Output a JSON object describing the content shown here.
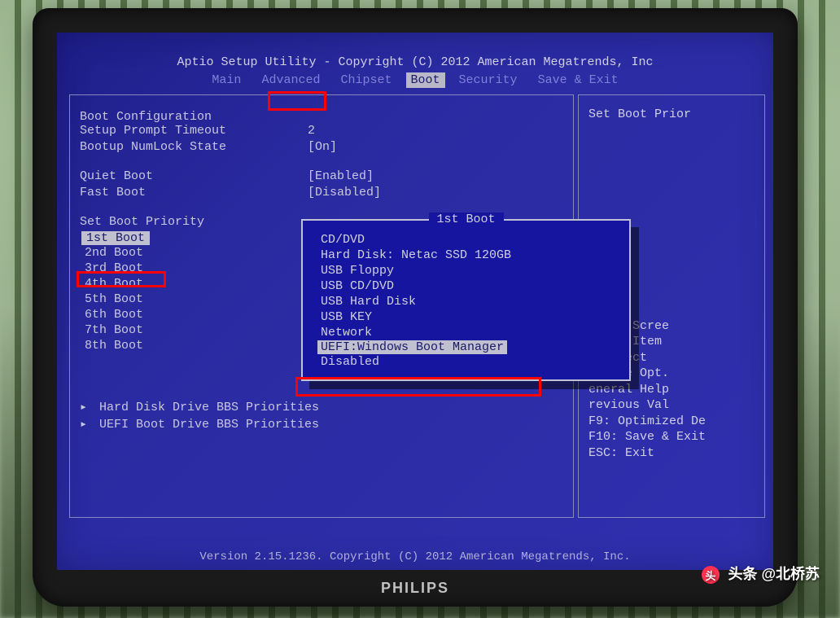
{
  "bios": {
    "header": "Aptio Setup Utility - Copyright (C) 2012 American Megatrends, Inc",
    "menu": {
      "items": [
        "Main",
        "Advanced",
        "Chipset",
        "Boot",
        "Security",
        "Save & Exit"
      ],
      "active": "Boot"
    },
    "config": {
      "section_header": "Boot Configuration",
      "items": [
        {
          "label": "Setup Prompt Timeout",
          "value": "2"
        },
        {
          "label": "Bootup NumLock State",
          "value": "[On]"
        }
      ]
    },
    "boot_mode": {
      "items": [
        {
          "label": "Quiet Boot",
          "value": "[Enabled]"
        },
        {
          "label": "Fast Boot",
          "value": "[Disabled]"
        }
      ]
    },
    "priority": {
      "header": "Set Boot Priority",
      "items": [
        "1st Boot",
        "2nd Boot",
        "3rd Boot",
        "4th Boot",
        "5th Boot",
        "6th Boot",
        "7th Boot",
        "8th Boot"
      ],
      "selected_index": 0
    },
    "submenus": [
      "Hard Disk Drive BBS Priorities",
      "UEFI Boot Drive BBS Priorities"
    ],
    "popup": {
      "title": "1st Boot",
      "options": [
        "CD/DVD",
        "Hard Disk: Netac SSD 120GB",
        "USB Floppy",
        "USB CD/DVD",
        "USB Hard Disk",
        "USB KEY",
        "Network",
        "UEFI:Windows Boot Manager",
        "Disabled"
      ],
      "selected_index": 7
    },
    "help": {
      "title": "Set Boot Prior",
      "keys": [
        "elect Scree",
        "elect Item",
        ": Select",
        "Change Opt.",
        "eneral Help",
        "revious Val",
        "F9: Optimized De",
        "F10: Save & Exit",
        "ESC: Exit"
      ]
    },
    "footer": "Version 2.15.1236. Copyright (C) 2012 American Megatrends, Inc."
  },
  "monitor": {
    "brand": "PHILIPS"
  },
  "watermark": "头条 @北桥苏"
}
